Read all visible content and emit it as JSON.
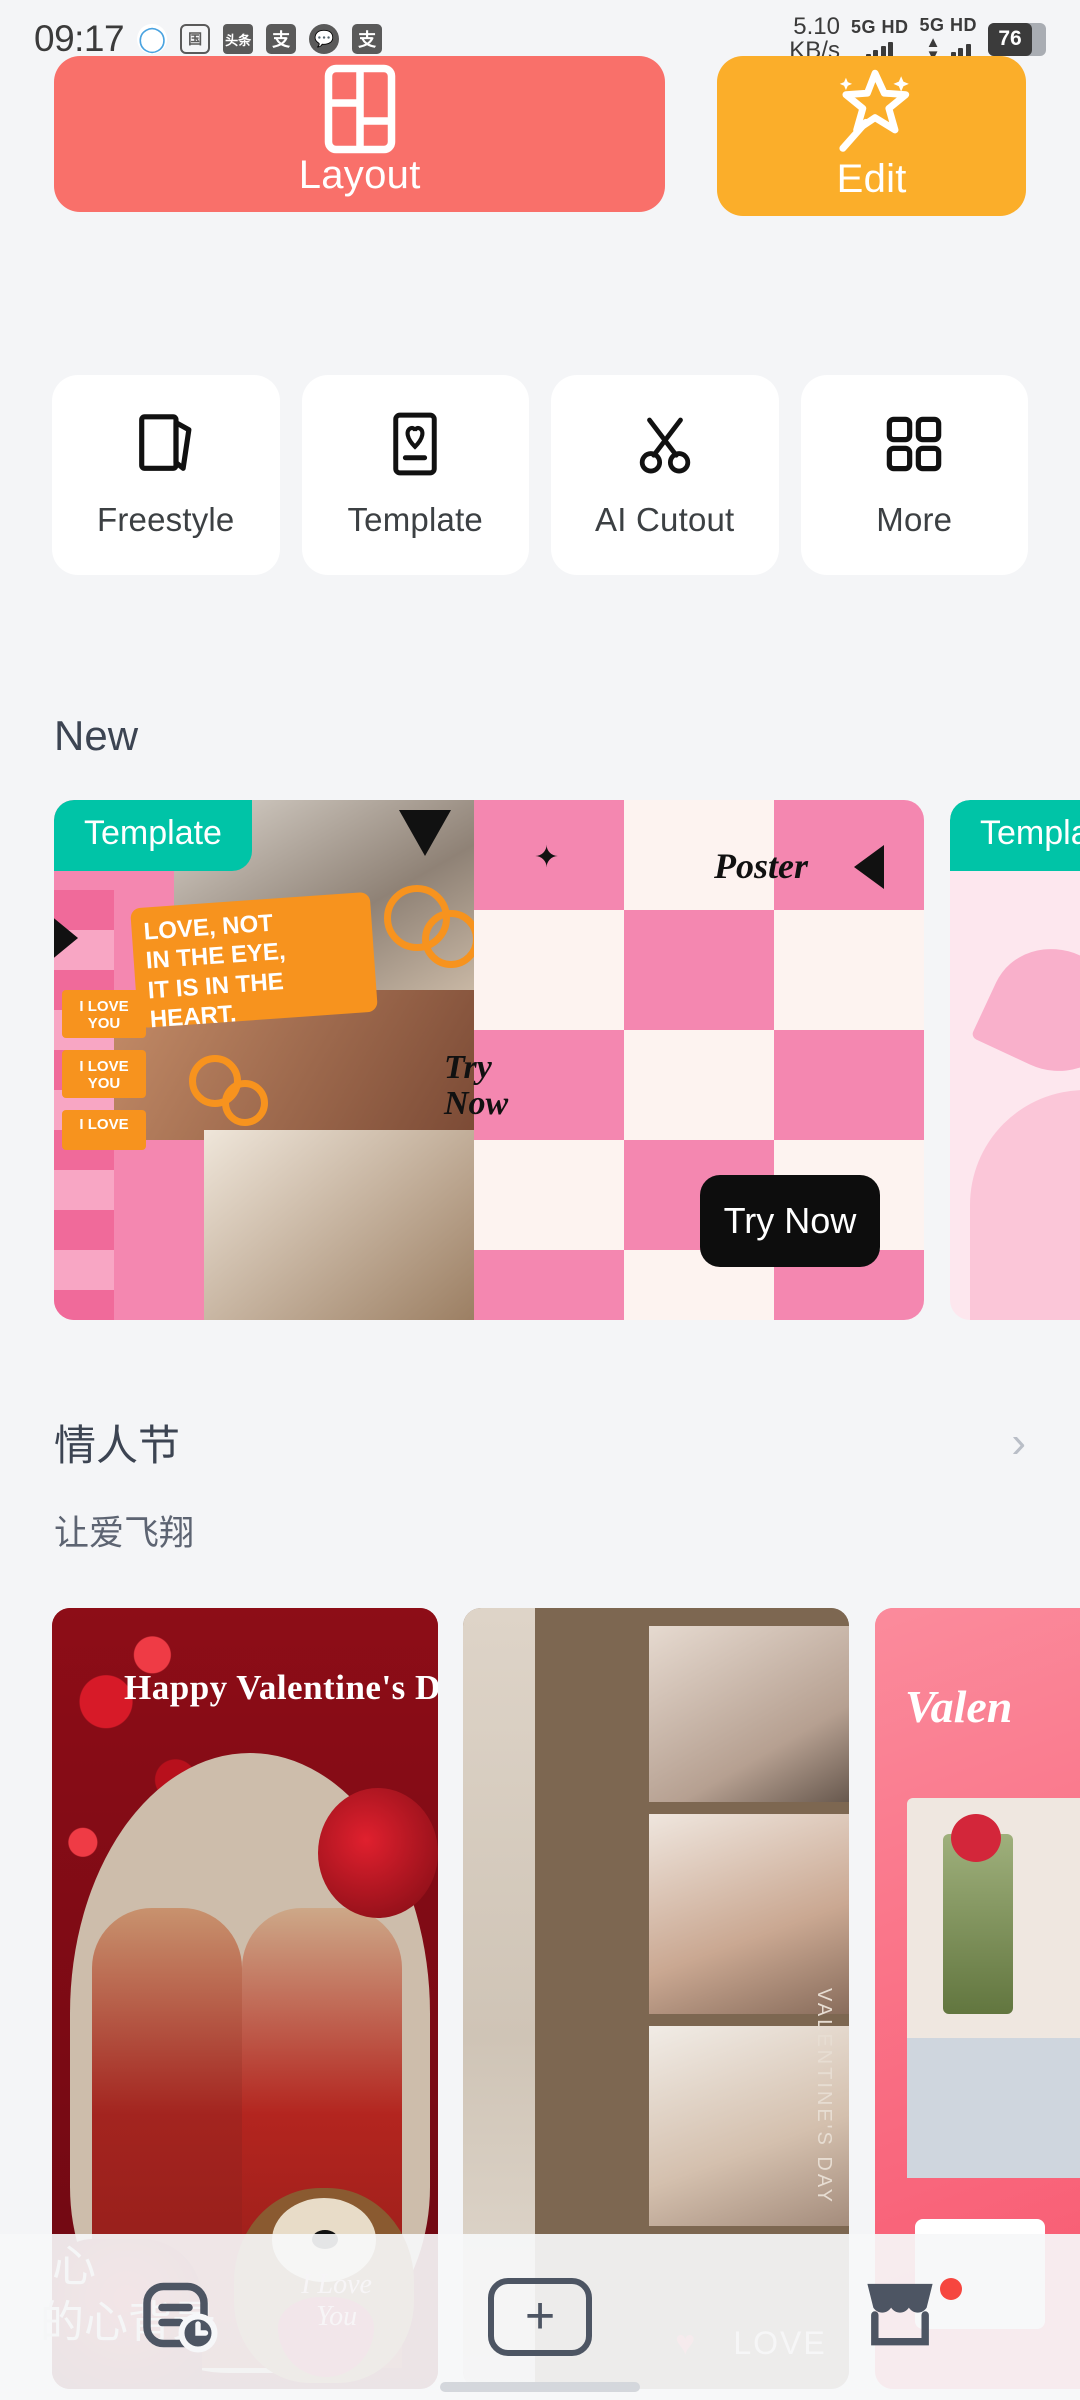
{
  "status_bar": {
    "time": "09:17",
    "app_icons": [
      "qq-icon",
      "guo-app-icon",
      "toutiao-icon",
      "alipay-icon",
      "wechat-icon",
      "alipay-icon-2"
    ],
    "network_speed_value": "5.10",
    "network_speed_unit": "KB/s",
    "sim1_label": "5G HD",
    "sim2_label": "5G HD",
    "battery_percent": "76"
  },
  "hero": {
    "layout": {
      "label": "Layout",
      "icon": "grid-layout-icon",
      "color": "#F9706A"
    },
    "edit": {
      "label": "Edit",
      "icon": "magic-wand-star-icon",
      "color": "#FBAE2A"
    }
  },
  "quick_tiles": [
    {
      "label": "Freestyle",
      "icon": "stacked-pages-icon"
    },
    {
      "label": "Template",
      "icon": "phone-heart-icon"
    },
    {
      "label": "AI Cutout",
      "icon": "scissors-icon"
    },
    {
      "label": "More",
      "icon": "grid-four-squares-icon"
    }
  ],
  "new_section": {
    "title": "New",
    "banners": [
      {
        "badge": "Template",
        "badge_color": "#00C4A7",
        "poster_text": "Poster",
        "quote_line1": "LOVE, NOT",
        "quote_line2": "IN THE EYE,",
        "quote_line3": "IT IS IN THE",
        "quote_line4": "HEART.",
        "sticker_text": "I LOVE YOU",
        "sticker_text2": "I LOVE YOU",
        "sticker_text3": "I LOVE",
        "try_script": "Try Now"
      },
      {
        "badge": "Template",
        "badge_color": "#00C4A7"
      }
    ],
    "cta_label": "Try Now",
    "cta_color": "#0D0D0D"
  },
  "valentine_section": {
    "title": "情人节",
    "subtitle": "让爱飞翔",
    "chevron": "chevron-right-icon",
    "cards": [
      {
        "headline": "Happy Valentine's D",
        "bear_text_line1": "I Love",
        "bear_text_line2": "You"
      },
      {
        "vertical_text": "VALENTINE'S DAY",
        "footer_label": "LOVE",
        "heart_left": "♥",
        "heart_right": "♥"
      },
      {
        "headline": "Valen"
      }
    ]
  },
  "ghost_layer": {
    "line1": "心",
    "line2": "的心背景"
  },
  "bottom_nav": [
    {
      "name": "recent-projects",
      "icon": "document-clock-icon",
      "badge": false
    },
    {
      "name": "create-new",
      "icon": "plus-icon",
      "badge": false
    },
    {
      "name": "store",
      "icon": "store-icon",
      "badge": true
    }
  ]
}
